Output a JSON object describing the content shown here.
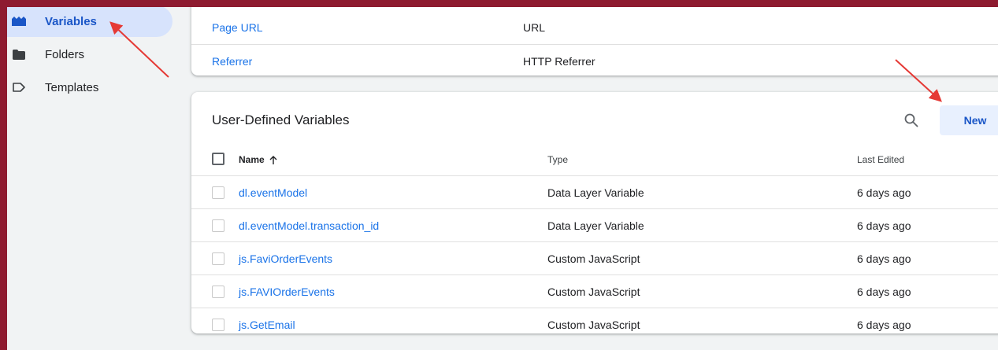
{
  "sidebar": {
    "items": [
      {
        "label": "Variables",
        "icon": "variables-icon",
        "active": true
      },
      {
        "label": "Folders",
        "icon": "folder-icon",
        "active": false
      },
      {
        "label": "Templates",
        "icon": "template-tag-icon",
        "active": false
      }
    ]
  },
  "built_in": {
    "rows": [
      {
        "name": "Page URL",
        "type": "URL"
      },
      {
        "name": "Referrer",
        "type": "HTTP Referrer"
      }
    ]
  },
  "user_defined": {
    "title": "User-Defined Variables",
    "search_icon": "search-icon",
    "new_label": "New",
    "columns": {
      "name": "Name",
      "type": "Type",
      "last_edited": "Last Edited"
    },
    "sort_icon": "arrow-up-icon",
    "rows": [
      {
        "name": "dl.eventModel",
        "type": "Data Layer Variable",
        "last_edited": "6 days ago"
      },
      {
        "name": "dl.eventModel.transaction_id",
        "type": "Data Layer Variable",
        "last_edited": "6 days ago"
      },
      {
        "name": "js.FaviOrderEvents",
        "type": "Custom JavaScript",
        "last_edited": "6 days ago"
      },
      {
        "name": "js.FAVIOrderEvents",
        "type": "Custom JavaScript",
        "last_edited": "6 days ago"
      },
      {
        "name": "js.GetEmail",
        "type": "Custom JavaScript",
        "last_edited": "6 days ago"
      }
    ]
  },
  "colors": {
    "frame": "#8e1b30",
    "accent": "#1a73e8",
    "annotation_arrow": "#e53935"
  }
}
